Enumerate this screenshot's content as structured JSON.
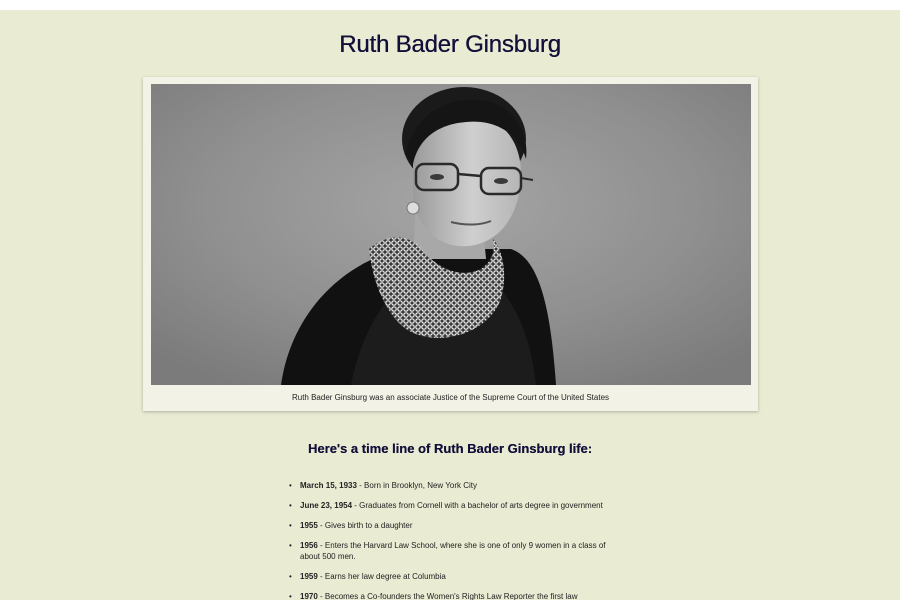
{
  "page": {
    "title": "Ruth Bader Ginsburg"
  },
  "figure": {
    "image_alt": "Portrait of Ruth Bader Ginsburg",
    "caption": "Ruth Bader Ginsburg was an associate Justice of the Supreme Court of the United States"
  },
  "timeline": {
    "heading": "Here's a time line of Ruth Bader Ginsburg life:",
    "items": [
      {
        "date": "March 15, 1933",
        "text": " - Born in Brooklyn, New York City"
      },
      {
        "date": "June 23, 1954",
        "text": " - Graduates from Cornell with a bachelor of arts degree in government"
      },
      {
        "date": "1955",
        "text": " - Gives birth to a daughter"
      },
      {
        "date": "1956",
        "text": " - Enters the Harvard Law School, where she is one of only 9 women in a class of about 500 men."
      },
      {
        "date": "1959",
        "text": " - Earns her law degree at Columbia"
      },
      {
        "date": "1970",
        "text": " - Becomes a Co-founders the Women's Rights Law Reporter the first law"
      }
    ]
  },
  "colors": {
    "page_background": "#eaebd3",
    "figure_background": "#f2f2e7",
    "title_color": "#120f3a"
  }
}
